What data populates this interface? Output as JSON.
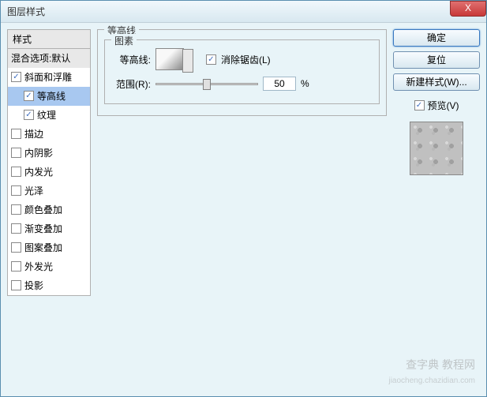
{
  "window": {
    "title": "图层样式"
  },
  "close_icon": "X",
  "styles": {
    "header": "样式",
    "blend_options": "混合选项:默认",
    "items": [
      {
        "label": "斜面和浮雕",
        "checked": true,
        "selected": false,
        "sub": false
      },
      {
        "label": "等高线",
        "checked": true,
        "selected": true,
        "sub": true
      },
      {
        "label": "纹理",
        "checked": true,
        "selected": false,
        "sub": true
      },
      {
        "label": "描边",
        "checked": false,
        "selected": false,
        "sub": false
      },
      {
        "label": "内阴影",
        "checked": false,
        "selected": false,
        "sub": false
      },
      {
        "label": "内发光",
        "checked": false,
        "selected": false,
        "sub": false
      },
      {
        "label": "光泽",
        "checked": false,
        "selected": false,
        "sub": false
      },
      {
        "label": "颜色叠加",
        "checked": false,
        "selected": false,
        "sub": false
      },
      {
        "label": "渐变叠加",
        "checked": false,
        "selected": false,
        "sub": false
      },
      {
        "label": "图案叠加",
        "checked": false,
        "selected": false,
        "sub": false
      },
      {
        "label": "外发光",
        "checked": false,
        "selected": false,
        "sub": false
      },
      {
        "label": "投影",
        "checked": false,
        "selected": false,
        "sub": false
      }
    ]
  },
  "main": {
    "section_title": "等高线",
    "elements_title": "图素",
    "contour_label": "等高线:",
    "antialias_label": "消除锯齿(L)",
    "antialias_checked": true,
    "range_label": "范围(R):",
    "range_value": "50",
    "range_unit": "%"
  },
  "buttons": {
    "ok": "确定",
    "cancel": "复位",
    "new_style": "新建样式(W)...",
    "preview": "预览(V)",
    "preview_checked": true
  },
  "watermark": {
    "line1": "查字典 教程网",
    "line2": "jiaocheng.chazidian.com"
  }
}
